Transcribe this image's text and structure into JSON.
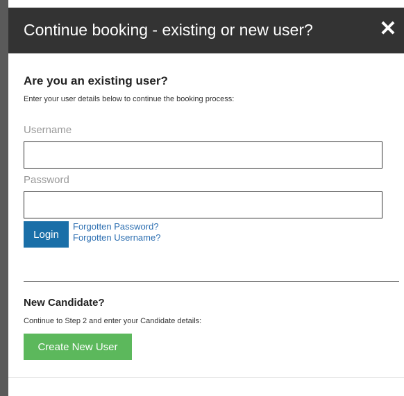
{
  "dialog": {
    "title": "Continue booking - existing or new user?",
    "close_glyph": "✕",
    "close_icon": "close-icon"
  },
  "existing_user": {
    "heading": "Are you an existing user?",
    "description": "Enter your user details below to continue the booking process:",
    "username_label": "Username",
    "username_value": "",
    "password_label": "Password",
    "password_value": "",
    "login_button": "Login",
    "forgot_password_link": "Forgotten Password?",
    "forgot_username_link": "Forgotten Username?"
  },
  "new_candidate": {
    "heading": "New Candidate?",
    "description": "Continue to Step 2 and enter your Candidate details:",
    "create_button": "Create New User"
  },
  "colors": {
    "header_bg": "#333333",
    "login_button": "#1a6fa8",
    "create_button": "#5cb85c",
    "link": "#2a6db0"
  }
}
